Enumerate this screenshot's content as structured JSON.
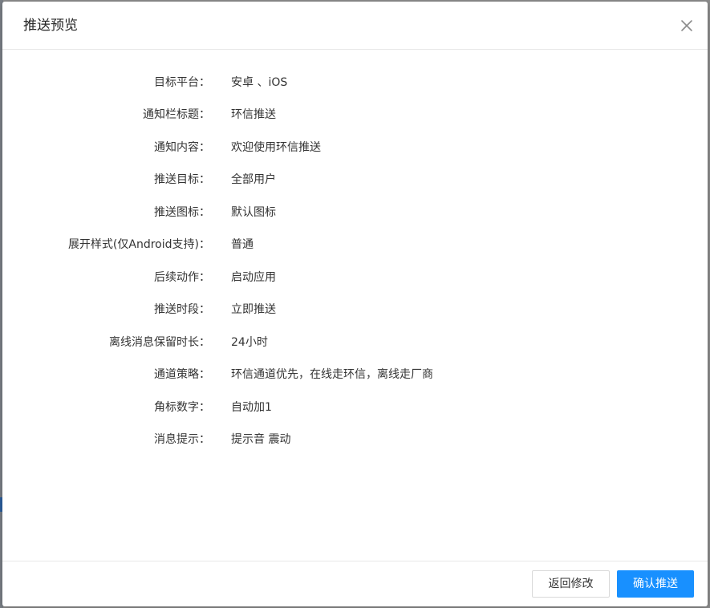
{
  "dialog": {
    "title": "推送预览",
    "close_icon": "close-icon"
  },
  "fields": [
    {
      "label": "目标平台：",
      "value": "安卓 、iOS"
    },
    {
      "label": "通知栏标题：",
      "value": "环信推送"
    },
    {
      "label": "通知内容：",
      "value": "欢迎使用环信推送"
    },
    {
      "label": "推送目标：",
      "value": "全部用户"
    },
    {
      "label": "推送图标：",
      "value": "默认图标"
    },
    {
      "label": "展开样式(仅Android支持)：",
      "value": "普通"
    },
    {
      "label": "后续动作：",
      "value": "启动应用"
    },
    {
      "label": "推送时段：",
      "value": "立即推送"
    },
    {
      "label": "离线消息保留时长：",
      "value": "24小时"
    },
    {
      "label": "通道策略：",
      "value": "环信通道优先，在线走环信，离线走厂商"
    },
    {
      "label": "角标数字：",
      "value": "自动加1"
    },
    {
      "label": "消息提示：",
      "value": "提示音 震动"
    }
  ],
  "footer": {
    "back_label": "返回修改",
    "confirm_label": "确认推送"
  },
  "colors": {
    "primary": "#1890ff",
    "text": "#333333",
    "border": "#e8e8e8",
    "overlay": "#8c8c8c"
  }
}
